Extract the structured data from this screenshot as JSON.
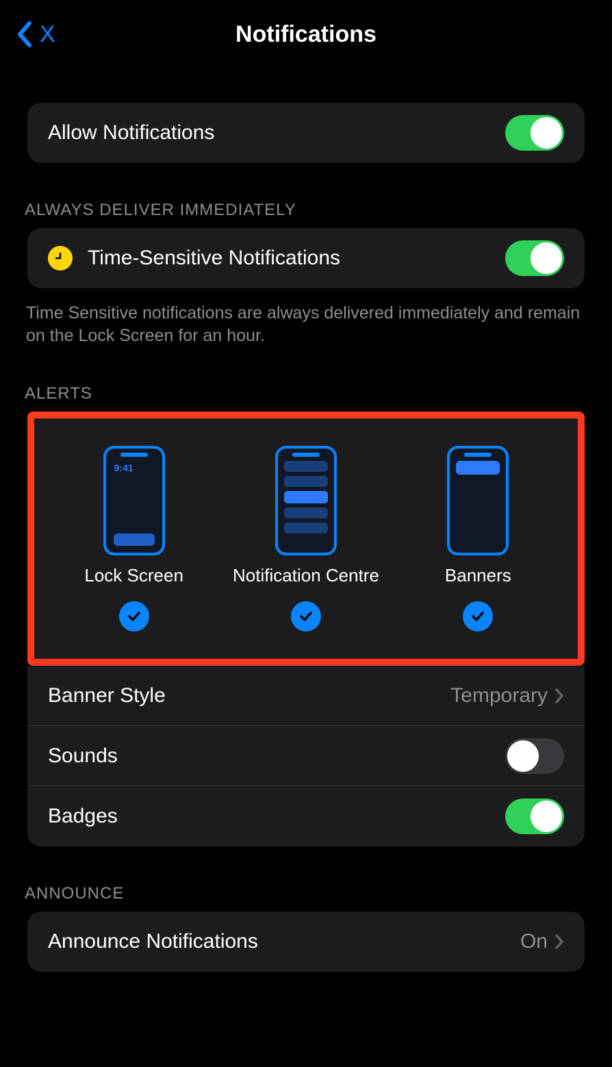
{
  "nav": {
    "back_label": "X",
    "title": "Notifications"
  },
  "allow": {
    "label": "Allow Notifications",
    "on": true
  },
  "always_deliver": {
    "header": "ALWAYS DELIVER IMMEDIATELY",
    "time_sensitive_label": "Time-Sensitive Notifications",
    "time_sensitive_on": true,
    "footer": "Time Sensitive notifications are always delivered immediately and remain on the Lock Screen for an hour."
  },
  "alerts": {
    "header": "ALERTS",
    "options": [
      {
        "label": "Lock Screen",
        "checked": true,
        "time": "9:41"
      },
      {
        "label": "Notification Centre",
        "checked": true
      },
      {
        "label": "Banners",
        "checked": true
      }
    ],
    "banner_style_label": "Banner Style",
    "banner_style_value": "Temporary",
    "sounds_label": "Sounds",
    "sounds_on": false,
    "badges_label": "Badges",
    "badges_on": true
  },
  "announce": {
    "header": "ANNOUNCE",
    "label": "Announce Notifications",
    "value": "On"
  },
  "colors": {
    "accent_blue": "#0a84ff",
    "toggle_green": "#30d158",
    "highlight_red": "#ff3a1f",
    "clock_yellow": "#ffd60a",
    "cell_bg": "#1c1c1e",
    "text_secondary": "#8e8e93"
  }
}
